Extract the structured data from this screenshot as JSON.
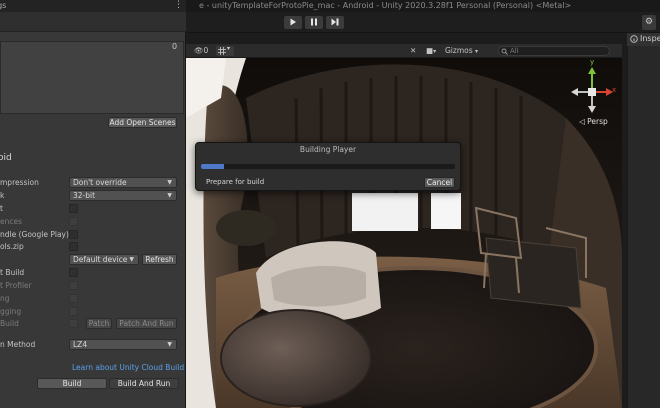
{
  "app": {
    "title": "e - unityTemplateForProtoPie_mac - Android - Unity 2020.3.28f1 Personal (Personal) <Metal>"
  },
  "playbar": {
    "play_icon": "play-icon",
    "pause_icon": "pause-icon",
    "step_icon": "step-icon"
  },
  "build_settings": {
    "title": "ngs",
    "scene_count": "0",
    "add_open_scenes": "Add Open Scenes",
    "platform": "oid",
    "rows": [
      {
        "label": "mpression",
        "value": "Don't override",
        "kind": "dropdown"
      },
      {
        "label": "k",
        "value": "32-bit",
        "kind": "dropdown"
      },
      {
        "label": "t",
        "kind": "checkbox"
      },
      {
        "label": "ences",
        "kind": "checkbox-disabled"
      },
      {
        "label": "ndle (Google Play)",
        "kind": "checkbox"
      },
      {
        "label": "ols.zip",
        "kind": "checkbox"
      }
    ],
    "run_device": {
      "value": "Default device",
      "refresh": "Refresh"
    },
    "dev_rows": [
      {
        "label": "t Build"
      },
      {
        "label": "t Profiler"
      },
      {
        "label": "ng"
      },
      {
        "label": "gging"
      },
      {
        "label": "Build"
      }
    ],
    "patch": "Patch",
    "patch_and_run": "Patch And Run",
    "compression_label": "n Method",
    "compression_value": "LZ4",
    "learn_link": "Learn about Unity Cloud Build",
    "build": "Build",
    "build_and_run": "Build And Run"
  },
  "scene_toolbar": {
    "count": "0",
    "gizmos": "Gizmos",
    "search_placeholder": "All"
  },
  "gizmo": {
    "x": "x",
    "y": "y",
    "persp": "Persp"
  },
  "inspector": {
    "tab": "Inspector"
  },
  "dialog": {
    "title": "Building Player",
    "status": "Prepare for build",
    "cancel": "Cancel",
    "progress": 0.09
  },
  "colors": {
    "accent": "#4f78c9",
    "link": "#5aa0ea",
    "gizmo_x": "#d9442f",
    "gizmo_y": "#7fc337"
  }
}
